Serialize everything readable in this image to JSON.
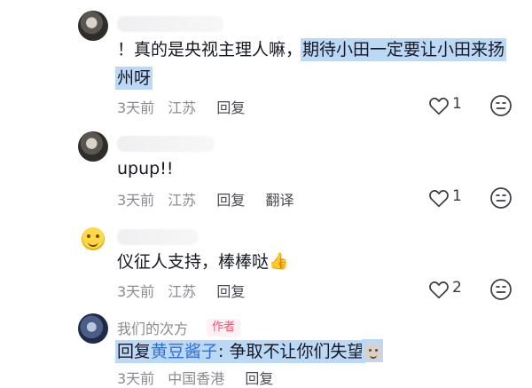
{
  "comments": [
    {
      "line1_prefix": "！真的是央视主理人嘛，",
      "line1_highlight": "期待小田一定要让小田来扬",
      "line2_highlight": "州呀",
      "meta": {
        "time": "3天前",
        "location": "江苏",
        "reply": "回复"
      },
      "likes": "1"
    },
    {
      "text": "upup!!",
      "meta": {
        "time": "3天前",
        "location": "江苏",
        "reply": "回复",
        "translate": "翻译"
      },
      "likes": "1"
    },
    {
      "text": "仪征人支持，棒棒哒",
      "thumb": "👍",
      "meta": {
        "time": "3天前",
        "location": "江苏",
        "reply": "回复"
      },
      "likes": "2"
    },
    {
      "nickname": "我们的次方",
      "badge": "作者",
      "reply_prefix": "回复",
      "reply_mention": "黄豆酱子",
      "reply_text": ": 争取不让你们失望",
      "meta": {
        "time": "3天前",
        "location": "中国香港",
        "reply": "回复"
      }
    }
  ],
  "icons": {
    "like": "heart-outline",
    "dislike": "neutral-face-outline",
    "emoji_avatar": "grinning-face",
    "sticker": "small-face-sticker"
  },
  "colors": {
    "highlight": "#bcd8f7",
    "mention": "#2f6fd6",
    "author_badge_text": "#ff4d70",
    "author_badge_bg": "#fff0f3",
    "meta": "#8a8b91",
    "text": "#161823"
  }
}
